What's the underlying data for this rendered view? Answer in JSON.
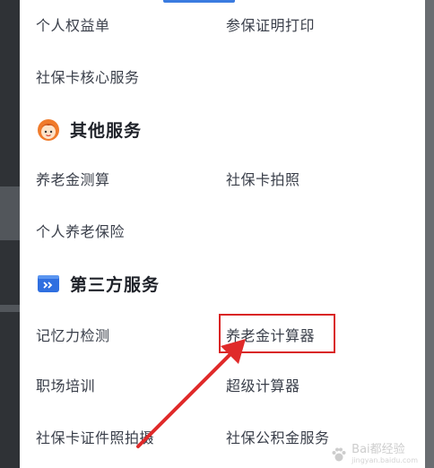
{
  "rows_top": {
    "row1_left": "个人权益单",
    "row1_right": "参保证明打印",
    "row2_left": "社保卡核心服务"
  },
  "section_other": {
    "title": "其他服务",
    "icon": "cartoon-face-icon",
    "items": [
      "养老金测算",
      "社保卡拍照",
      "个人养老保险"
    ]
  },
  "section_third": {
    "title": "第三方服务",
    "icon": "card-arrows-icon",
    "items": [
      "记忆力检测",
      "养老金计算器",
      "职场培训",
      "超级计算器",
      "社保卡证件照拍摄",
      "社保公积金服务"
    ]
  },
  "watermark": {
    "text": "Bai都经验",
    "sub": "jingyan.baidu.com"
  },
  "colors": {
    "accent_blue": "#3a7be0",
    "highlight_red": "#d92525",
    "icon_orange": "#f07b2b"
  }
}
